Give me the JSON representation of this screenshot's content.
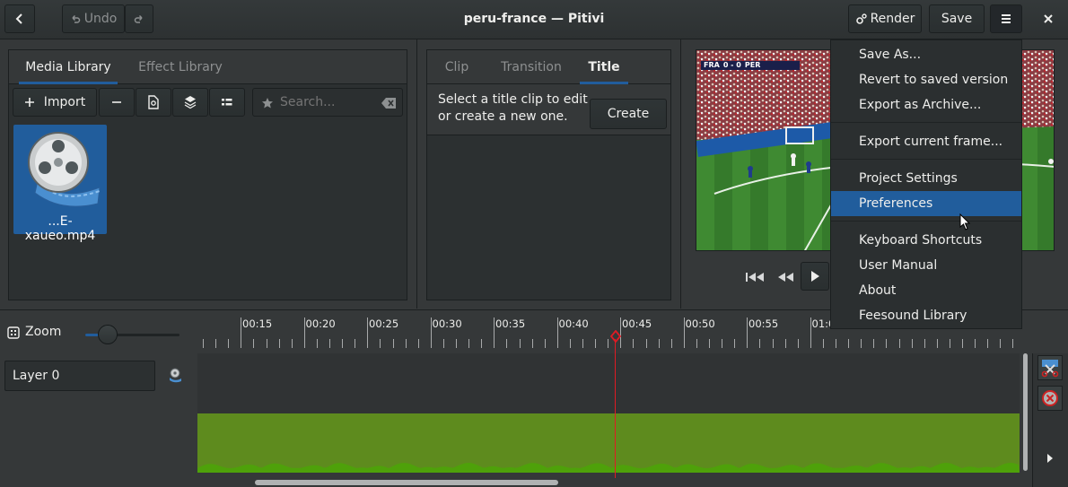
{
  "header": {
    "back_label": "back",
    "undo_label": "Undo",
    "title": "peru-france — Pitivi",
    "render_label": "Render",
    "save_label": "Save"
  },
  "library": {
    "tabs": [
      "Media Library",
      "Effect Library"
    ],
    "import_label": "Import",
    "search_placeholder": "Search...",
    "clip_name": "...E-xaueo.mp4"
  },
  "clip_panel": {
    "tabs": [
      "Clip",
      "Transition",
      "Title"
    ],
    "message": "Select a title clip to edit or create a new one.",
    "message_line1": "Select a title clip to edit",
    "message_line2": "or create a new one.",
    "create_label": "Create"
  },
  "viewer": {
    "scoreboard": {
      "team1": "FRA",
      "score": "0 - 0",
      "team2": "PER"
    }
  },
  "menu": {
    "items": [
      "Save As...",
      "Revert to saved version",
      "Export as Archive...",
      "Export current frame...",
      "Project Settings",
      "Preferences",
      "Keyboard Shortcuts",
      "User Manual",
      "About",
      "Feesound Library"
    ],
    "selected": "Preferences"
  },
  "timeline": {
    "zoom_label": "Zoom",
    "layer_name": "Layer 0",
    "ruler_labels": [
      "00:15",
      "00:20",
      "00:25",
      "00:30",
      "00:35",
      "00:40",
      "00:45",
      "00:50",
      "00:55",
      "01:0"
    ],
    "playhead_time": "00:43"
  },
  "colors": {
    "accent": "#215d9c",
    "audio_track": "#5e8b1e",
    "waveform": "#4ea10a",
    "playhead": "#e01b24"
  }
}
